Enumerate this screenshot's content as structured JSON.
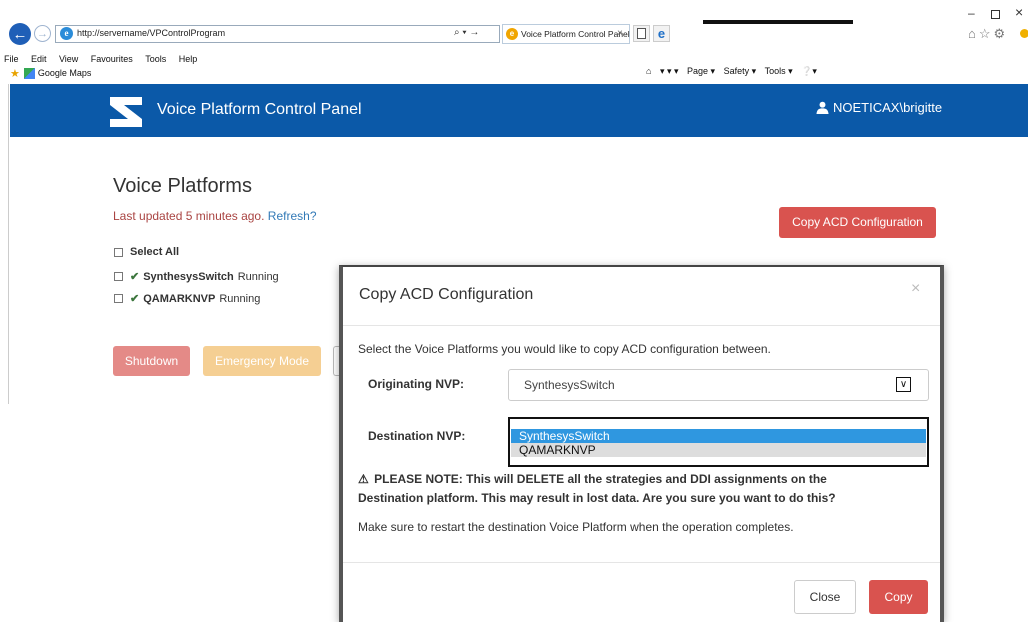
{
  "browser": {
    "url": "http://servername/VPControlProgram",
    "address_tools": "⌕ ▾ →",
    "tab_title": "Voice Platform Control Panel",
    "tab_close": "×",
    "menu": [
      "File",
      "Edit",
      "View",
      "Favourites",
      "Tools",
      "Help"
    ],
    "favorite": "Google Maps",
    "command_bar": [
      "▾ ▾ ▾",
      "Page ▾",
      "Safety ▾",
      "Tools ▾",
      "▾"
    ],
    "right_icons": "⌂☆⚙"
  },
  "app": {
    "title": "Voice Platform Control Panel",
    "user": "NOETICAX\\brigitte"
  },
  "page": {
    "title": "Voice Platforms",
    "last_updated": "Last updated 5 minutes ago.",
    "refresh": "Refresh?",
    "copy_acd_button": "Copy ACD Configuration",
    "select_all": "Select All",
    "platforms": [
      {
        "name": "SynthesysSwitch",
        "status": "Running"
      },
      {
        "name": "QAMARKNVP",
        "status": "Running"
      }
    ],
    "shutdown_button": "Shutdown",
    "emergency_button": "Emergency Mode"
  },
  "modal": {
    "title": "Copy ACD Configuration",
    "close_x": "×",
    "description": "Select the Voice Platforms you would like to copy ACD configuration between.",
    "originating_label": "Originating NVP:",
    "originating_value": "SynthesysSwitch",
    "destination_label": "Destination NVP:",
    "destination_options": [
      "SynthesysSwitch",
      "QAMARKNVP"
    ],
    "warning_line1": "PLEASE NOTE: This will DELETE all the strategies and DDI assignments on the",
    "warning_line2": "Destination platform. This may result in lost data. Are you sure you want to do this?",
    "restart_note": "Make sure to restart the destination Voice Platform when the operation completes.",
    "close_button": "Close",
    "copy_button": "Copy"
  },
  "colors": {
    "header": "#0b59a8",
    "danger": "#d9534f",
    "warning": "#f5cf93",
    "selected_option": "#2f97e0"
  }
}
